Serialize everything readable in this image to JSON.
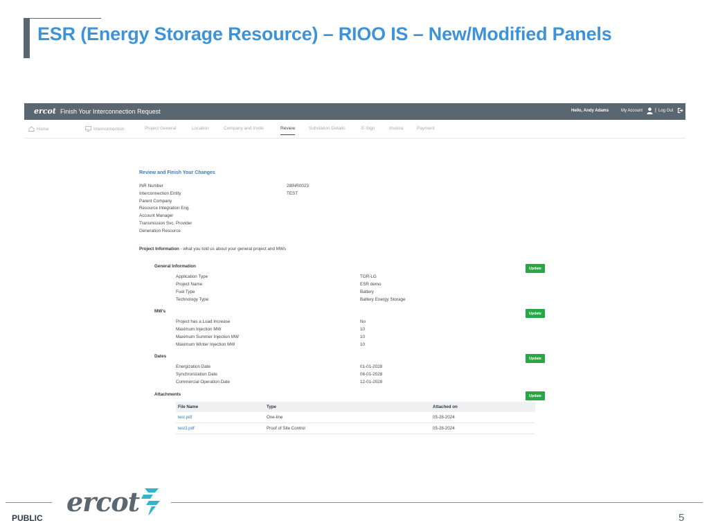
{
  "slide": {
    "title": "ESR (Energy Storage Resource) – RIOO IS – New/Modified Panels",
    "footer_label": "PUBLIC",
    "page_number": "5",
    "logo_text": "ercot"
  },
  "app": {
    "logo_text": "ercot",
    "title": "Finish Your Interconnection Request",
    "greeting": "Hello, Andy Adams",
    "my_account": "My Account",
    "separator": "|",
    "logout": "Log Out",
    "nav": [
      {
        "label": "Home",
        "icon": "home-icon",
        "active": false
      },
      {
        "label": "Interconnection",
        "icon": "monitor-icon",
        "active": false
      },
      {
        "label": "Project General",
        "active": false
      },
      {
        "label": "Location",
        "active": false
      },
      {
        "label": "Company and Invite",
        "active": false
      },
      {
        "label": "Review",
        "active": true
      },
      {
        "label": "Substation Details",
        "active": false
      },
      {
        "label": "E-Sign",
        "active": false
      },
      {
        "label": "Invoice",
        "active": false
      },
      {
        "label": "Payment",
        "active": false
      }
    ]
  },
  "review": {
    "heading": "Review and Finish Your Changes",
    "summary": [
      {
        "label": "INR Number",
        "value": "28INR0023"
      },
      {
        "label": "Interconnection Entity",
        "value": "TEST"
      },
      {
        "label": "Parent Company",
        "value": ""
      },
      {
        "label": "Resource Integration Eng.",
        "value": ""
      },
      {
        "label": "Account Manager",
        "value": ""
      },
      {
        "label": "Transmission Svc. Provider",
        "value": ""
      },
      {
        "label": "Generation Resource",
        "value": ""
      }
    ],
    "project_info_label": "Project Information",
    "project_info_sub": " - what you told us about your general project and MWs",
    "update_label": "Update",
    "general": {
      "heading": "General Information",
      "rows": [
        {
          "label": "Application Type",
          "value": "TGR-LG"
        },
        {
          "label": "Project Name",
          "value": "ESR demo"
        },
        {
          "label": "Fuel Type",
          "value": "Battery"
        },
        {
          "label": "Technology Type",
          "value": "Battery Energy Storage"
        }
      ]
    },
    "mws": {
      "heading": "MW's",
      "rows": [
        {
          "label": "Project has a Load Increase",
          "value": "No"
        },
        {
          "label": "Maximum Injection MW",
          "value": "10"
        },
        {
          "label": "Maximum Summer Injection MW",
          "value": "10"
        },
        {
          "label": "Maximum Winter Injection MW",
          "value": "10"
        }
      ]
    },
    "dates": {
      "heading": "Dates",
      "rows": [
        {
          "label": "Energization Date",
          "value": "01-01-2028"
        },
        {
          "label": "Synchronization Date",
          "value": "06-01-2028"
        },
        {
          "label": "Commercial Operation Date",
          "value": "12-01-2028"
        }
      ]
    },
    "attachments": {
      "heading": "Attachments",
      "columns": [
        "File Name",
        "Type",
        "Attached on"
      ],
      "rows": [
        {
          "file": "test.pdf",
          "type": "One-line",
          "date": "05-28-2024"
        },
        {
          "file": "test3.pdf",
          "type": "Proof of Site Control",
          "date": "05-28-2024"
        }
      ]
    }
  },
  "colors": {
    "title_blue": "#3d93d5",
    "header_gray": "#5b6770",
    "update_green": "#28a745",
    "link_blue": "#3a78c0"
  }
}
